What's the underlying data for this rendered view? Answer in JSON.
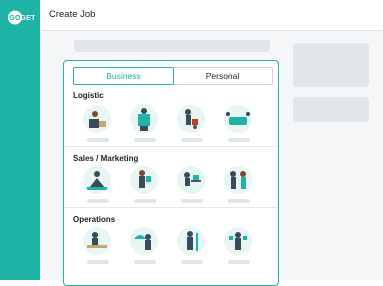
{
  "app": {
    "logo_text": "GO GET",
    "page_title": "Create Job"
  },
  "tabs": [
    {
      "label": "Business",
      "active": true
    },
    {
      "label": "Personal",
      "active": false
    }
  ],
  "sections": [
    {
      "title": "Logistic",
      "items": [
        "warehouse-worker-icon",
        "box-carrier-icon",
        "hand-truck-icon",
        "sofa-movers-icon"
      ]
    },
    {
      "title": "Sales / Marketing",
      "items": [
        "meditating-promoter-icon",
        "flyer-distributor-icon",
        "desk-worker-icon",
        "sales-duo-icon"
      ]
    },
    {
      "title": "Operations",
      "items": [
        "reception-worker-icon",
        "umbrella-attendant-icon",
        "cleaner-icon",
        "waiter-icon"
      ]
    }
  ],
  "colors": {
    "brand": "#1fb3a6",
    "skeleton": "#e3e6e9"
  }
}
